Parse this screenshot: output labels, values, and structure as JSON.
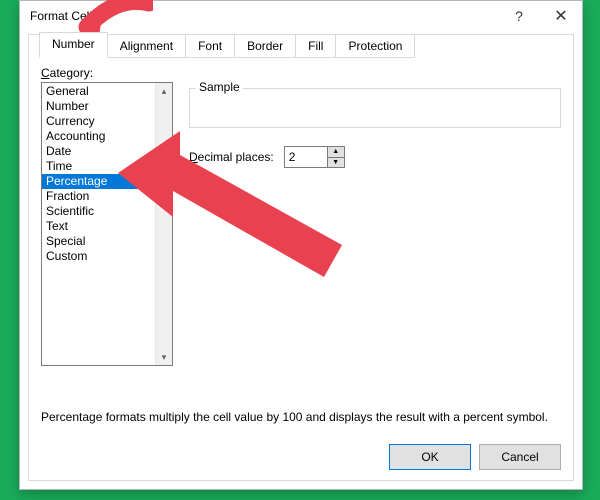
{
  "title": "Format Cells",
  "tabs": [
    "Number",
    "Alignment",
    "Font",
    "Border",
    "Fill",
    "Protection"
  ],
  "activeTab": 0,
  "categoryLabel": "ategory:",
  "categoryAccess": "C",
  "categories": [
    "General",
    "Number",
    "Currency",
    "Accounting",
    "Date",
    "Time",
    "Percentage",
    "Fraction",
    "Scientific",
    "Text",
    "Special",
    "Custom"
  ],
  "selectedCategoryIndex": 6,
  "sampleLabel": "Sample",
  "sampleValue": "",
  "decimalLabel": "ecimal places:",
  "decimalAccess": "D",
  "decimalValue": "2",
  "description": "Percentage formats multiply the cell value by 100 and displays the result with a percent symbol.",
  "ok": "OK",
  "cancel": "Cancel",
  "arrowColor": "#e84150"
}
